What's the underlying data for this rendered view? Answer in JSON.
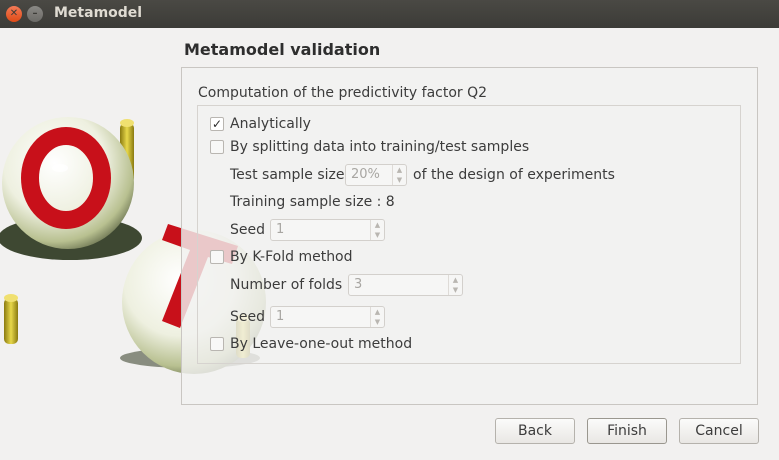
{
  "window": {
    "title": "Metamodel"
  },
  "page": {
    "title": "Metamodel validation",
    "group_title": "Computation of the predictivity factor Q2"
  },
  "options": {
    "analytically": {
      "label": "Analytically",
      "checked": true
    },
    "splitting": {
      "label": "By splitting data into training/test samples",
      "checked": false
    },
    "test_sample_size_label": "Test sample size",
    "test_sample_size_value": "20%",
    "test_sample_size_suffix": "of the design of experiments",
    "training_sample_size": "Training sample size : 8",
    "seed_label": "Seed",
    "seed_value": "1",
    "kfold": {
      "label": "By K-Fold method",
      "checked": false
    },
    "folds_label": "Number of folds",
    "folds_value": "3",
    "kfold_seed_label": "Seed",
    "kfold_seed_value": "1",
    "loo": {
      "label": "By Leave-one-out method",
      "checked": false
    }
  },
  "buttons": {
    "back": "Back",
    "finish": "Finish",
    "cancel": "Cancel"
  },
  "check_mark": "✓",
  "colors": {
    "titlebar": "#3c3b37",
    "close": "#df4a16",
    "logo_red": "#c8101a",
    "logo_rod": "#c9b227"
  }
}
